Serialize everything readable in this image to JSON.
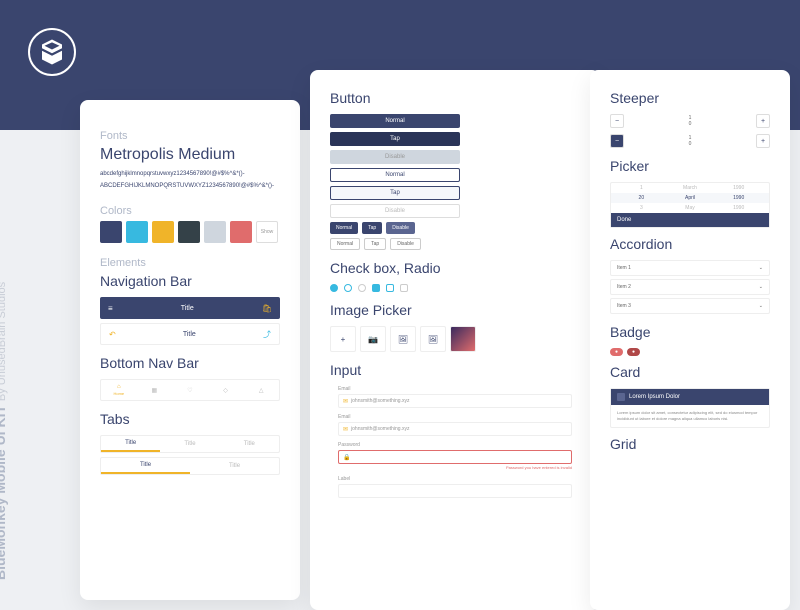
{
  "brand": {
    "title": "BlueMonkey Mobile UI KIT",
    "subtitle": "By UnusedBrain Studios"
  },
  "fonts": {
    "label": "Fonts",
    "title": "Metropolis Medium",
    "sample1": "abcdefghijklmnopqrstuvwxyz1234567890!@#$%^&*()-",
    "sample2": "ABCDEFGHIJKLMNOPQRSTUVWXYZ1234567890!@#$%^&*()-"
  },
  "colors": {
    "label": "Colors",
    "show": "Show"
  },
  "elements": {
    "label": "Elements"
  },
  "navbar": {
    "title": "Navigation Bar",
    "text": "Title"
  },
  "bottomnav": {
    "title": "Bottom Nav Bar",
    "home": "Home"
  },
  "tabs": {
    "title": "Tabs",
    "t1": "Title",
    "t2": "Title",
    "t3": "Title"
  },
  "button": {
    "title": "Button",
    "normal": "Normal",
    "tap": "Tap",
    "disable": "Disable"
  },
  "checkbox": {
    "title": "Check box, Radio"
  },
  "imagepicker": {
    "title": "Image Picker"
  },
  "input": {
    "title": "Input",
    "email": "Email",
    "placeholder": "johnsmith@something.xyz",
    "password": "Password",
    "err": "Password you have entered is invalid",
    "label": "Label"
  },
  "steeper": {
    "title": "Steeper",
    "v1a": "1",
    "v1b": "0",
    "v2a": "1",
    "v2b": "0"
  },
  "picker": {
    "title": "Picker",
    "r1": [
      "1",
      "March",
      "1990"
    ],
    "r2": [
      "20",
      "April",
      "1990"
    ],
    "r3": [
      "3",
      "May",
      "1990"
    ],
    "done": "Done"
  },
  "accordion": {
    "title": "Accordion",
    "i1": "Item 1",
    "i2": "Item 2",
    "i3": "Item 3"
  },
  "badge": {
    "title": "Badge"
  },
  "card": {
    "title": "Card",
    "header": "Lorem Ipsum Dolor",
    "body": "Lorem ipsum dolor sit amet, consectetur adipiscing elit, sed do eiusmod tempor incididunt ut labore et dolore magna aliqua ullamco laboris nisi."
  },
  "grid": {
    "title": "Grid"
  }
}
